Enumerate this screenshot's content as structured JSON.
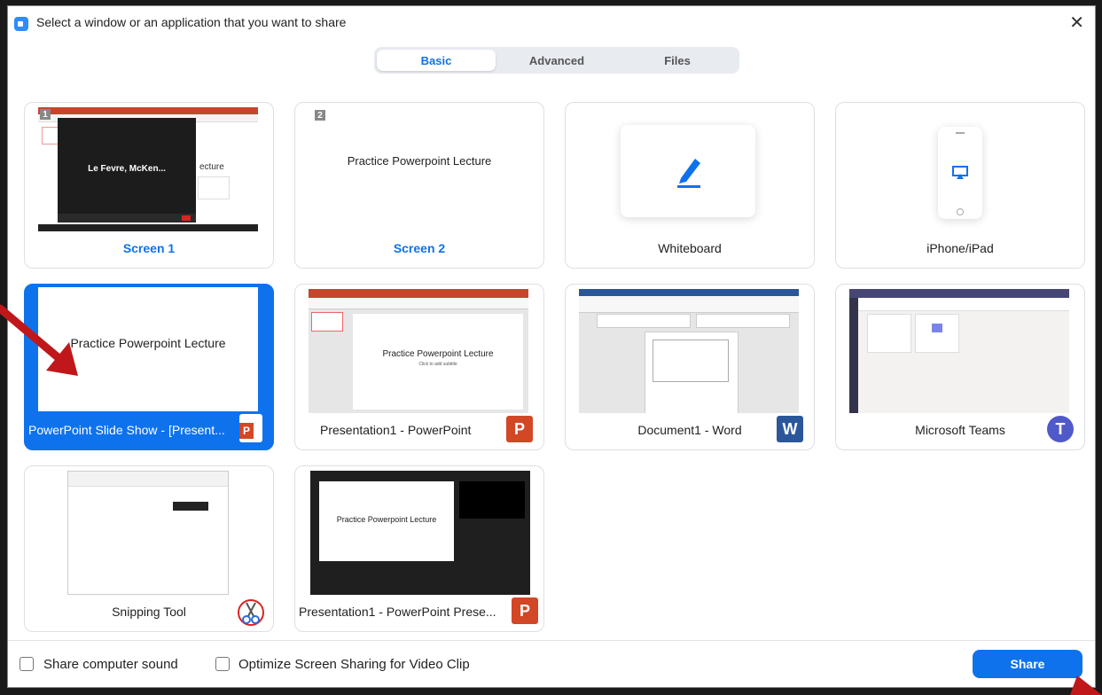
{
  "window": {
    "title": "Select a window or an application that you want to share",
    "close_glyph": "✕"
  },
  "tabs": [
    {
      "label": "Basic",
      "active": true
    },
    {
      "label": "Advanced",
      "active": false
    },
    {
      "label": "Files",
      "active": false
    }
  ],
  "tiles": [
    {
      "label": "Screen 1",
      "number": "1",
      "meeting_name": "Le Fevre, McKen...",
      "slide_text": "ecture"
    },
    {
      "label": "Screen 2",
      "number": "2",
      "slide_text": "Practice Powerpoint Lecture"
    },
    {
      "label": "Whiteboard",
      "icon": "pen-icon"
    },
    {
      "label": "iPhone/iPad",
      "icon": "airplay-icon"
    },
    {
      "label": "PowerPoint Slide Show - [Present...",
      "slide_text": "Practice Powerpoint Lecture",
      "selected": true,
      "icon": "powerpoint-show-icon"
    },
    {
      "label": "Presentation1 - PowerPoint",
      "slide_text": "Practice Powerpoint Lecture",
      "slide_subtext": "Click to add subtitle",
      "icon": "powerpoint-icon"
    },
    {
      "label": "Document1 - Word",
      "icon": "word-icon"
    },
    {
      "label": "Microsoft Teams",
      "icon": "teams-icon"
    },
    {
      "label": "Snipping Tool",
      "icon": "snipping-tool-icon"
    },
    {
      "label": "Presentation1 - PowerPoint Prese...",
      "slide_text": "Practice Powerpoint Lecture",
      "icon": "powerpoint-presenter-icon"
    }
  ],
  "footer": {
    "sound_label": "Share computer sound",
    "optimize_label": "Optimize Screen Sharing for Video Clip",
    "share_label": "Share"
  },
  "colors": {
    "accent": "#0e72ed",
    "arrow": "#c0171b"
  }
}
